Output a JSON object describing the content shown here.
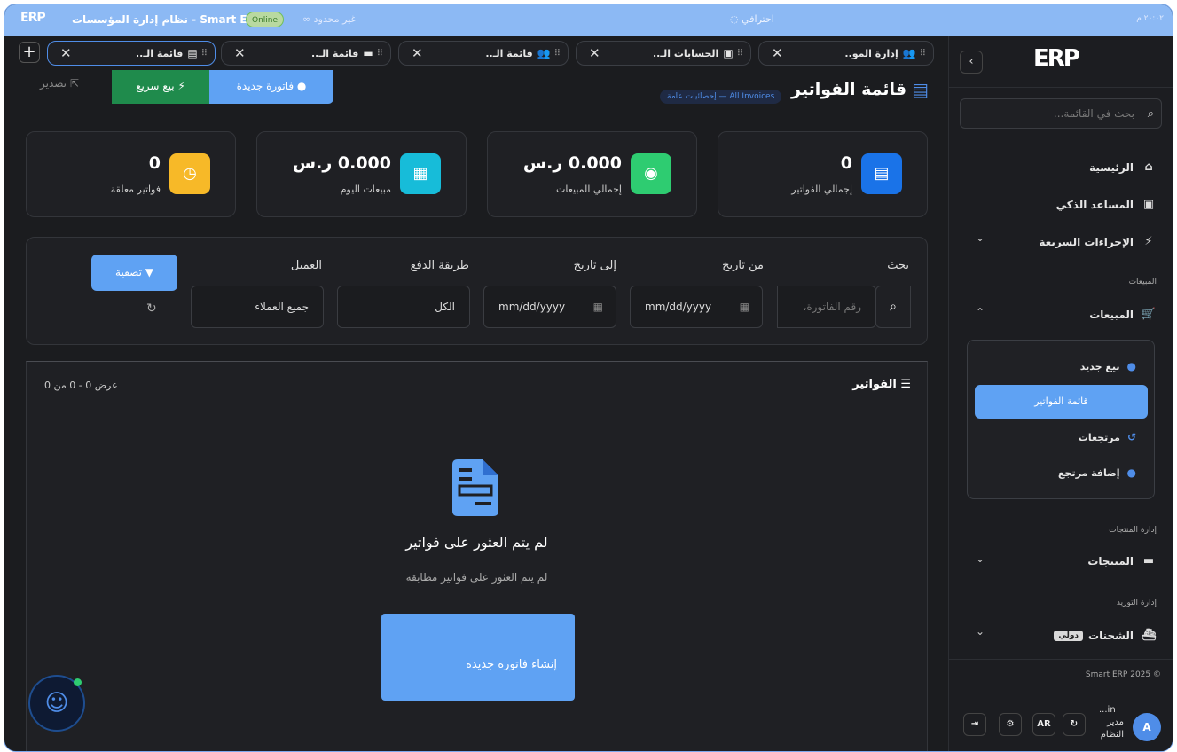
{
  "topbar": {
    "logo": "ERP",
    "app_name": "Smart ERP - نظام إدارة المؤسسات",
    "live_badge": "Online",
    "unlimited": "غير محدود",
    "pro": "احترافي",
    "clock": "٢٠:٠٢ م"
  },
  "tabs": [
    {
      "label": "إدارة المو..",
      "icon": "users-icon"
    },
    {
      "label": "الحسابات الـ..",
      "icon": "wallet-icon"
    },
    {
      "label": "قائمة الـ..",
      "icon": "user-group-icon"
    },
    {
      "label": "قائمة الـ..",
      "icon": "card-icon"
    },
    {
      "label": "قائمة الـ..",
      "icon": "register-icon",
      "active": true
    }
  ],
  "sidebar": {
    "logo": "ERP",
    "search_placeholder": "بحث في القائمة...",
    "home": "الرئيسية",
    "assistant": "المساعد الذكي",
    "quick_actions": "الإجراءات السريعة",
    "section_sales": "المبيعات",
    "sales": "المبيعات",
    "sub": {
      "new_sale": "بيع جديد",
      "invoices_list": "قائمة الفواتير",
      "returns": "مرتجعات",
      "add_return": "إضافة مرتجع"
    },
    "section_products": "إدارة المنتجات",
    "products": "المنتجات",
    "section_supply": "إدارة التوريد",
    "shipments": "الشحنات",
    "shipments_badge": "دولي",
    "copyright": "© Smart ERP 2025",
    "lang": "AR",
    "user_name": "...in",
    "user_role": "مدير النظام",
    "avatar": "A"
  },
  "main": {
    "title": "قائمة الفواتير",
    "badge": "All Invoices — إحصائيات عامة",
    "btn_new": "فاتورة جديدة",
    "btn_quick": "بيع سريع",
    "btn_export": "تصدير",
    "stats": [
      {
        "value": "0",
        "label": "إجمالي الفواتير",
        "color": "#1a73e8"
      },
      {
        "value": "0.000 ر.س",
        "label": "إجمالي المبيعات",
        "color": "#2ecc71"
      },
      {
        "value": "0.000 ر.س",
        "label": "مبيعات اليوم",
        "color": "#17bcd9"
      },
      {
        "value": "0",
        "label": "فواتير معلقة",
        "color": "#f7b928"
      }
    ],
    "filters": {
      "search_label": "بحث",
      "search_placeholder": "رقم الفاتورة،",
      "from_label": "من تاريخ",
      "from_value": "mm/dd/yyyy",
      "to_label": "إلى تاريخ",
      "to_value": "mm/dd/yyyy",
      "payment_label": "طريقة الدفع",
      "payment_value": "الكل",
      "customer_label": "العميل",
      "customer_value": "جميع العملاء",
      "filter_btn": "تصفية"
    },
    "list": {
      "title": "الفواتير",
      "count": "عرض 0 - 0 من 0",
      "empty_title": "لم يتم العثور على فواتير",
      "empty_sub": "لم يتم العثور على فواتير مطابقة",
      "create_btn": "إنشاء فاتورة جديدة"
    }
  }
}
